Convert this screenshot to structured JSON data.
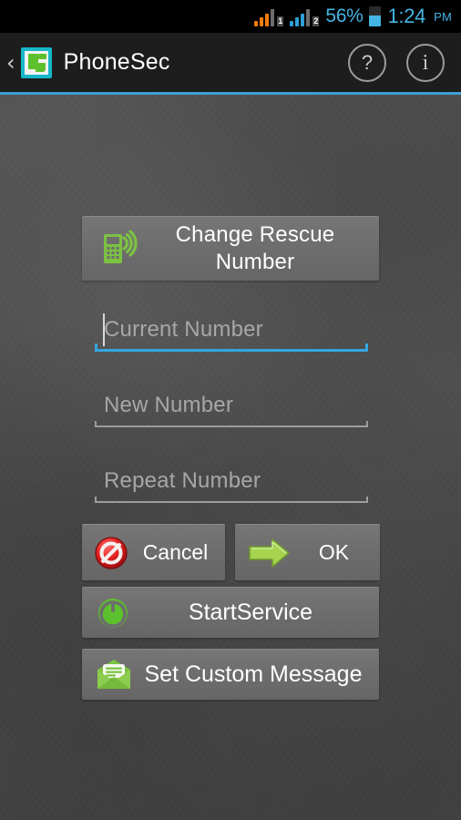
{
  "status_bar": {
    "signal_1": {
      "icon": "signal-bars-icon",
      "sim_label": "1",
      "color": "#f07c10",
      "bars": 3
    },
    "signal_2": {
      "icon": "signal-bars-icon",
      "sim_label": "2",
      "color": "#2f9fd8",
      "bars": 3
    },
    "battery_percent": "56%",
    "battery_icon": "battery-icon",
    "battery_level": 56,
    "time": "1:24",
    "am_pm": "PM",
    "accent_color": "#44b4e4"
  },
  "action_bar": {
    "back_icon": "back-chevron-icon",
    "back_glyph": "‹",
    "app_icon": "phonesec-app-icon",
    "title": "PhoneSec",
    "help_icon": "help-icon",
    "help_glyph": "?",
    "info_icon": "info-icon",
    "info_glyph": "i",
    "divider_color": "#3d9fd8",
    "background_color": "#1d1d1d"
  },
  "main": {
    "change_rescue_button": {
      "label": "Change Rescue\nNumber",
      "line1": "Change Rescue",
      "line2": "Number",
      "icon": "phone-signal-icon",
      "icon_color": "#7cc242"
    },
    "fields": [
      {
        "name": "current-number",
        "placeholder": "Current Number",
        "value": "",
        "focused": true
      },
      {
        "name": "new-number",
        "placeholder": "New Number",
        "value": "",
        "focused": false
      },
      {
        "name": "repeat-number",
        "placeholder": "Repeat Number",
        "value": "",
        "focused": false
      }
    ],
    "cancel_button": {
      "label": "Cancel",
      "icon": "prohibition-icon",
      "icon_color": "#e02020"
    },
    "ok_button": {
      "label": "OK",
      "icon": "arrow-right-icon",
      "icon_color": "#a6d44f"
    },
    "start_service_button": {
      "label": "StartService",
      "icon": "power-icon",
      "icon_color": "#5cc12c"
    },
    "custom_message_button": {
      "label": "Set Custom Message",
      "icon": "envelope-message-icon",
      "icon_color": "#7cc242"
    },
    "button_face_color": "#6d6d6d",
    "wallpaper_color": "#4b4b4b"
  }
}
